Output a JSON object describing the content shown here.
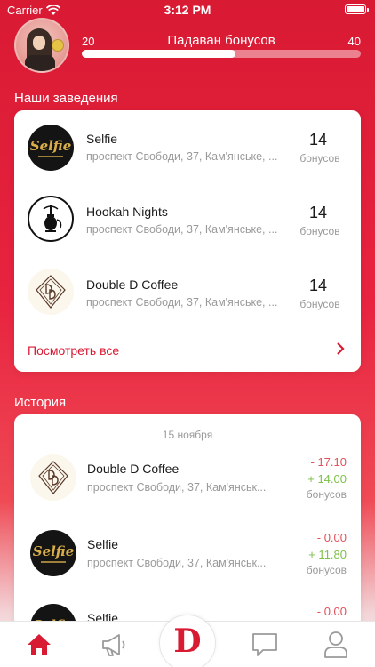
{
  "status_bar": {
    "carrier": "Carrier",
    "time": "3:12 PM"
  },
  "level": {
    "min": "20",
    "max": "40",
    "title": "Падаван бонусов",
    "progress": 0.55
  },
  "venues": {
    "title": "Наши заведения",
    "items": [
      {
        "name": "Selfie",
        "address": "проспект Свободи, 37, Кам'янське, ...",
        "bonus": "14",
        "bonus_label": "бонусов",
        "logo": "selfie-logo",
        "logo_text": "Selfie"
      },
      {
        "name": "Hookah Nights",
        "address": "проспект Свободи, 37, Кам'янське, ...",
        "bonus": "14",
        "bonus_label": "бонусов",
        "logo": "hookah-logo"
      },
      {
        "name": "Double D Coffee",
        "address": "проспект Свободи, 37, Кам'янське, ...",
        "bonus": "14",
        "bonus_label": "бонусов",
        "logo": "dd-coffee-logo"
      }
    ],
    "see_all": "Посмотреть все"
  },
  "history": {
    "title": "История",
    "date": "15 ноября",
    "items": [
      {
        "name": "Double D Coffee",
        "address": "проспект Свободи, 37, Кам'янськ...",
        "minus": "- 17.10",
        "plus": "+ 14.00",
        "label": "бонусов"
      },
      {
        "name": "Selfie",
        "address": "проспект Свободи, 37, Кам'янськ...",
        "minus": "- 0.00",
        "plus": "+ 11.80",
        "label": "бонусов"
      },
      {
        "name": "Selfie",
        "address": "",
        "minus": "- 0.00",
        "plus": "",
        "label": ""
      }
    ]
  },
  "tab_bar": {
    "center_label": "D",
    "active_color": "#d91a33",
    "inactive_color": "#9a9a9a"
  }
}
